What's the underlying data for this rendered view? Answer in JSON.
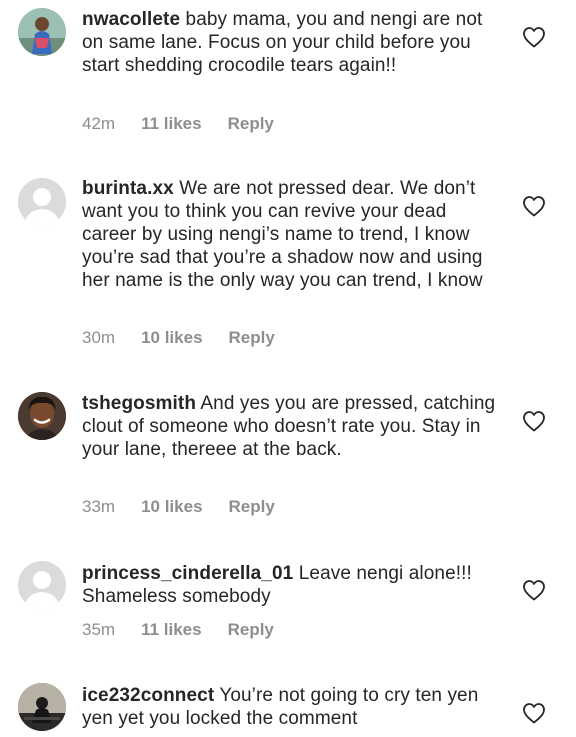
{
  "comments": [
    {
      "username": "nwacollete",
      "text": "baby mama, you and nengi are not on same lane. Focus on your child before you start shedding crocodile tears again!!",
      "time": "42m",
      "likes": "11 likes",
      "reply": "Reply"
    },
    {
      "username": "burinta.xx",
      "text": "We are not pressed dear. We don’t want you to think you can revive your dead career by using nengi’s name to trend, I know you’re sad that you’re a shadow now and using her name is the only way you can trend, I know",
      "time": "30m",
      "likes": "10 likes",
      "reply": "Reply"
    },
    {
      "username": "tshegosmith",
      "text": "And yes you are pressed, catching clout of someone who doesn’t rate you. Stay in your lane, thereee at the back.",
      "time": "33m",
      "likes": "10 likes",
      "reply": "Reply"
    },
    {
      "username": "princess_cinderella_01",
      "text": "Leave nengi alone!!! Shameless somebody",
      "time": "35m",
      "likes": "11 likes",
      "reply": "Reply"
    },
    {
      "username": "ice232connect",
      "text": "You’re not going to cry ten yen yen yet you locked the comment"
    }
  ]
}
